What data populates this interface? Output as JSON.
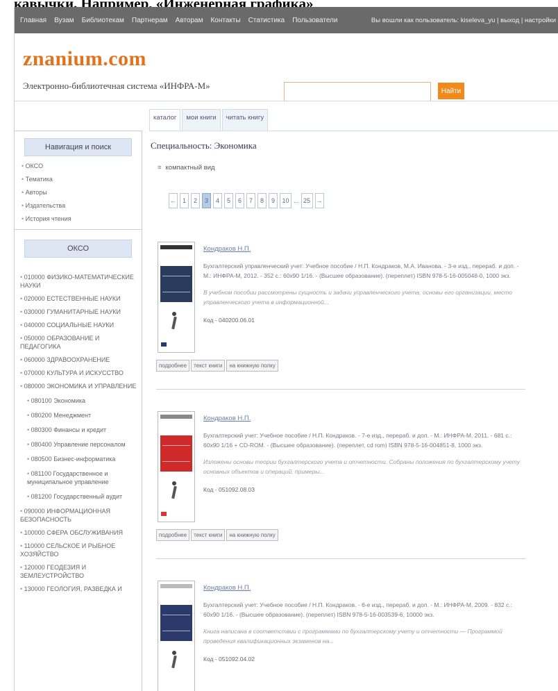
{
  "document_caption": "кавычки. Например, «Инженерная графика»",
  "topnav": {
    "items": [
      "Главная",
      "Вузам",
      "Библиотекам",
      "Партнерам",
      "Авторам",
      "Контакты",
      "Статистика",
      "Пользователи"
    ],
    "user_text": "Вы вошли как пользователь: kiseleva_yu",
    "logout": "выход",
    "settings": "настройки"
  },
  "header": {
    "logo": "znanium.com",
    "tagline": "Электронно-библиотечная система «ИНФРА-М»",
    "search_placeholder": "",
    "search_button": "Найти"
  },
  "tabs": [
    {
      "label": "каталог",
      "active": true
    },
    {
      "label": "мои книги",
      "active": false
    },
    {
      "label": "читать книгу",
      "active": false
    }
  ],
  "sidebar": {
    "nav_title": "Навигация и поиск",
    "nav_items": [
      "ОКСО",
      "Тематика",
      "Авторы",
      "Издательства",
      "История чтения"
    ],
    "okso_title": "ОКСО",
    "okso_items": [
      "010000 ФИЗИКО-МАТЕМАТИЧЕСКИЕ НАУКИ",
      "020000 ЕСТЕСТВЕННЫЕ НАУКИ",
      "030000 ГУМАНИТАРНЫЕ НАУКИ",
      "040000 СОЦИАЛЬНЫЕ НАУКИ",
      "050000 ОБРАЗОВАНИЕ И ПЕДАГОГИКА",
      "060000 ЗДРАВООХРАНЕНИЕ",
      "070000 КУЛЬТУРА И ИСКУССТВО",
      "080000 ЭКОНОМИКА И УПРАВЛЕНИЕ"
    ],
    "okso_sub": [
      "080100 Экономика",
      "080200 Менеджмент",
      "080300 Финансы и кредит",
      "080400 Управление персоналом",
      "080500 Бизнес-информатика",
      "081100 Государственное и муниципальное управление",
      "081200 Государственный аудит"
    ],
    "okso_items_after": [
      "090000 ИНФОРМАЦИОННАЯ БЕЗОПАСНОСТЬ",
      "100000 СФЕРА ОБСЛУЖИВАНИЯ",
      "110000 СЕЛЬСКОЕ И РЫБНОЕ ХОЗЯЙСТВО",
      "120000 ГЕОДЕЗИЯ И ЗЕМЛЕУСТРОЙСТВО",
      "130000 ГЕОЛОГИЯ, РАЗВЕДКА И"
    ]
  },
  "main": {
    "specialty": "Специальность: Экономика",
    "compact_view": "компактный вид",
    "pagination": [
      "←",
      "1",
      "2",
      "3",
      "4",
      "5",
      "6",
      "7",
      "8",
      "9",
      "10",
      "...",
      "25",
      "→"
    ],
    "current_page": "3",
    "books": [
      {
        "author": "Кондраков Н.П.",
        "description": "Бухгалтерский управленческий учет: Учебное пособие / Н.П. Кондраков, М.А. Иванова. - 3-е изд., перераб. и доп. - М.: ИНФРА-М, 2012. - 352 с.: 60x90 1/16. - (Высшее образование). (переплет) ISBN 978-5-16-005048-0, 1000 экз.",
        "annotation": "В учебном пособии рассмотрены сущность и задачи управленческого учета, основы его организации, место управленческого учета в информационной...",
        "code": "Код - 040200.06.01",
        "cover_color": "#2a3c5e",
        "actions": [
          "подробнее",
          "текст книги",
          "на книжную полку"
        ]
      },
      {
        "author": "Кондраков Н.П.",
        "description": "Бухгалтерский учет: Учебное пособие / Н.П. Кондраков. - 7-е изд., перераб. и доп. - М.: ИНФРА-М, 2011. - 681 с.: 60x90 1/16 + CD-ROM. - (Высшее образование). (переплет, cd rom) ISBN 978-5-16-004851-8, 1000 экз.",
        "annotation": "Изложены основы теории бухгалтерского учета и отчетности. Собраны положения по бухгалтерскому учету основных объектов и операций, примеры...",
        "code": "Код - 051092.08.03",
        "cover_color": "#cf2a2a",
        "actions": [
          "подробнее",
          "текст книги",
          "на книжную полку"
        ]
      },
      {
        "author": "Кондраков Н.П.",
        "description": "Бухгалтерский учет: Учебное пособие / Н.П. Кондраков. - 6-е изд., перераб. и доп. - М.: ИНФРА-М, 2009. - 832 с.: 60x90 1/16. - (Высшее образование). (переплет) ISBN 978-5-16-003539-6, 10000 экз.",
        "annotation": "Книга написана в соответствии с программами по бухгалтерскому учету и отчетности — Программой проведения квалификационных экзаменов на...",
        "code": "Код - 051092.04.02",
        "cover_color": "#2b3a6b",
        "actions": [
          "подробнее",
          "текст книги",
          "на книжную полку"
        ]
      }
    ]
  }
}
